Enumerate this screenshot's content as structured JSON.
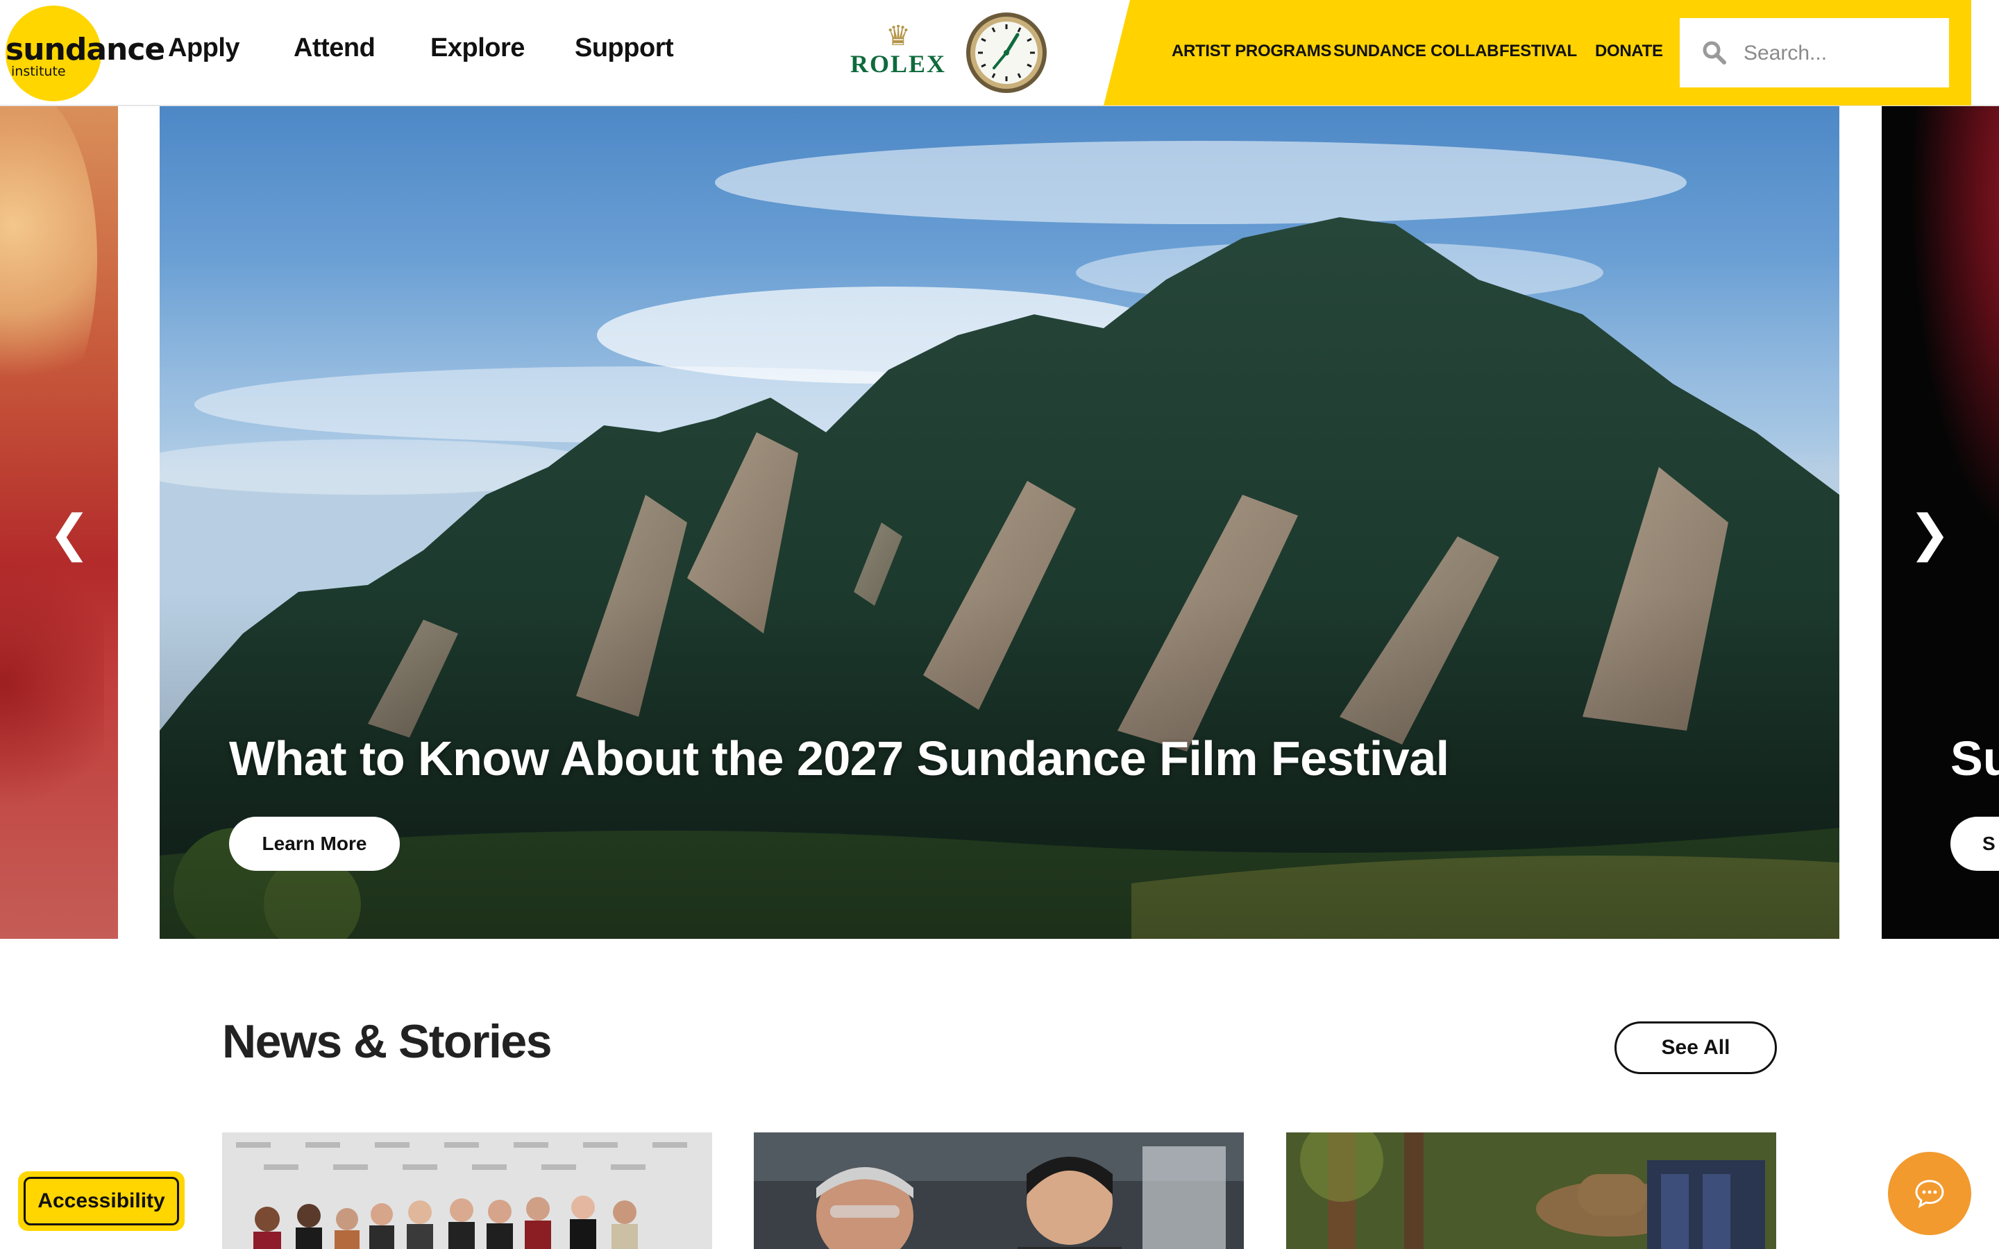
{
  "brand": {
    "logo_word": "sundance",
    "logo_sub": "institute",
    "accent": "#ffd600",
    "sponsor_name": "ROLEX",
    "sponsor_green": "#0f6a3c"
  },
  "main_nav": [
    "Apply",
    "Attend",
    "Explore",
    "Support"
  ],
  "utility_nav": [
    "ARTIST PROGRAMS",
    "SUNDANCE COLLAB",
    "FESTIVAL",
    "DONATE"
  ],
  "search": {
    "placeholder": "Search...",
    "value": "",
    "icon": "search-icon"
  },
  "hero": {
    "active_slide": {
      "title": "What to Know About the 2027 Sundance Film Festival",
      "button_label": "Learn More"
    },
    "next_slide_peek": {
      "title": "Su",
      "button_label": "S"
    },
    "prev_arrow": "❮",
    "next_arrow": "❯"
  },
  "news": {
    "heading": "News & Stories",
    "see_all_label": "See All",
    "cards": [
      {
        "image": "premiere-group-photo"
      },
      {
        "image": "two-people-workshop"
      },
      {
        "image": "man-in-hat-forest"
      }
    ]
  },
  "accessibility_label": "Accessibility",
  "chat_icon": "chat-bubble-icon"
}
